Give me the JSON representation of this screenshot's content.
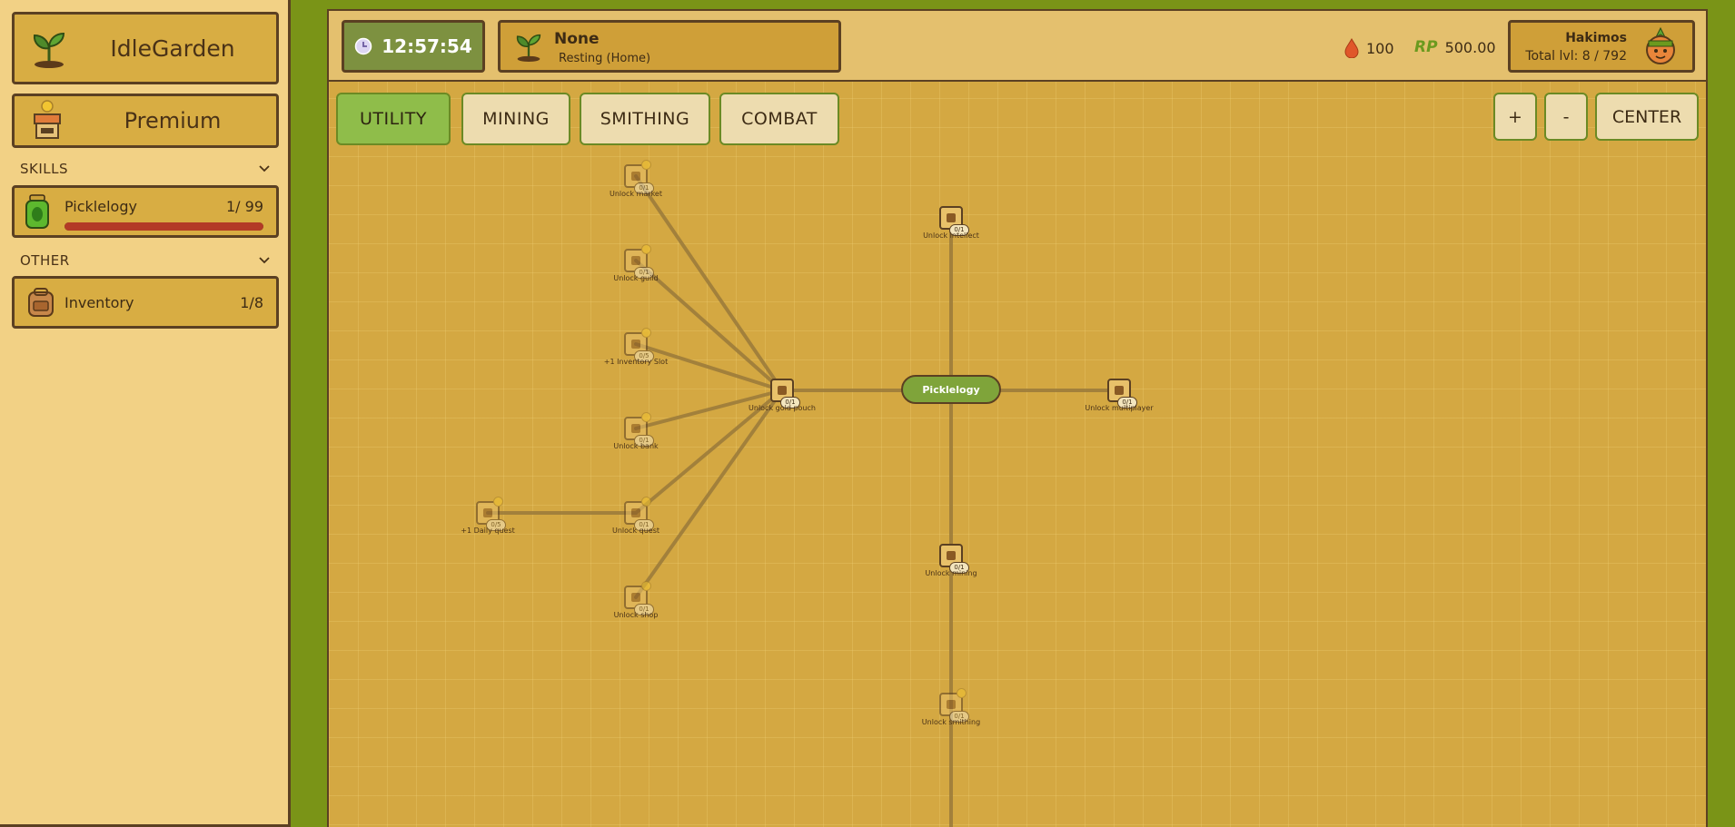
{
  "sidebar": {
    "brand": "IdleGarden",
    "premium": "Premium",
    "skills_heading": "SKILLS",
    "skills": [
      {
        "name": "Picklelogy",
        "level": "1/ 99",
        "progress": 1.0
      }
    ],
    "other_heading": "OTHER",
    "other": [
      {
        "name": "Inventory",
        "value": "1/8"
      }
    ]
  },
  "topbar": {
    "clock": "12:57:54",
    "activity": {
      "name": "None",
      "status": "Resting (Home)"
    },
    "water": "100",
    "rp_label": "RP",
    "rp": "500.00",
    "user": {
      "name": "Hakimos",
      "total_level": "Total lvl: 8 / 792"
    }
  },
  "tabs": [
    {
      "label": "UTILITY",
      "active": true
    },
    {
      "label": "MINING",
      "active": false
    },
    {
      "label": "SMITHING",
      "active": false
    },
    {
      "label": "COMBAT",
      "active": false
    }
  ],
  "controls": {
    "zoom_in": "+",
    "zoom_out": "-",
    "center": "CENTER"
  },
  "tree": {
    "root": "Picklelogy",
    "nodes": [
      {
        "id": "market",
        "label": "Unlock market",
        "badge": "0/1",
        "locked": true
      },
      {
        "id": "guild",
        "label": "Unlock guild",
        "badge": "0/1",
        "locked": true
      },
      {
        "id": "inv",
        "label": "+1 Inventory Slot",
        "badge": "0/5",
        "locked": true
      },
      {
        "id": "bank",
        "label": "Unlock bank",
        "badge": "0/1",
        "locked": true
      },
      {
        "id": "quest",
        "label": "Unlock quest",
        "badge": "0/1",
        "locked": true
      },
      {
        "id": "daily",
        "label": "+1 Daily quest",
        "badge": "0/5",
        "locked": true
      },
      {
        "id": "shop",
        "label": "Unlock shop",
        "badge": "0/1",
        "locked": true
      },
      {
        "id": "pouch",
        "label": "Unlock gold pouch",
        "badge": "0/1",
        "locked": false
      },
      {
        "id": "intel",
        "label": "Unlock intellect",
        "badge": "0/1",
        "locked": false
      },
      {
        "id": "multi",
        "label": "Unlock multiplayer",
        "badge": "0/1",
        "locked": false
      },
      {
        "id": "mining",
        "label": "Unlock mining",
        "badge": "0/1",
        "locked": false
      },
      {
        "id": "smithing",
        "label": "Unlock smithing",
        "badge": "0/1",
        "locked": true
      }
    ]
  }
}
